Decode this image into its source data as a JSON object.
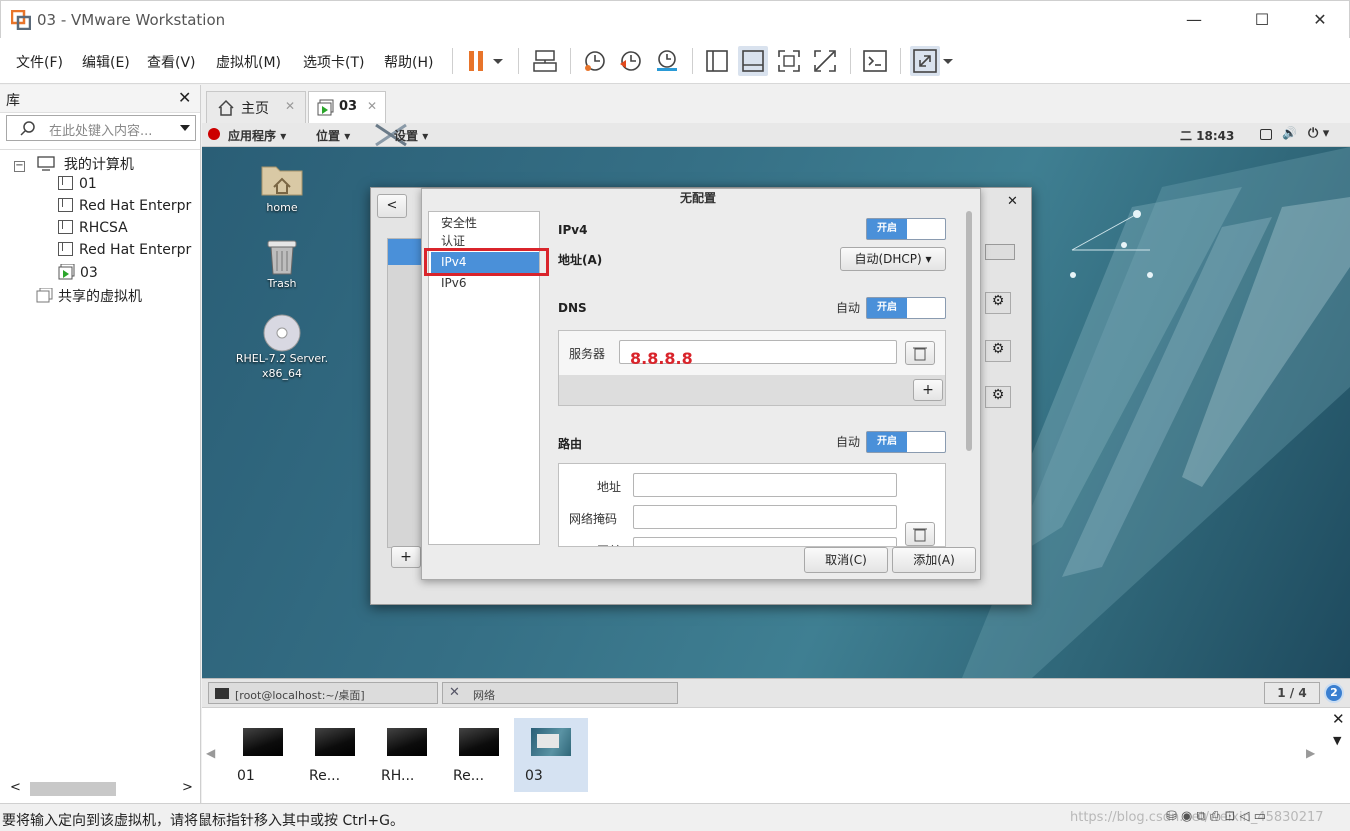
{
  "window": {
    "title": "03 - VMware Workstation",
    "minimize": "—",
    "maximize": "☐",
    "close": "✕"
  },
  "menu": [
    "文件(F)",
    "编辑(E)",
    "查看(V)",
    "虚拟机(M)",
    "选项卡(T)",
    "帮助(H)"
  ],
  "library": {
    "title": "库",
    "close": "✕",
    "search_placeholder": "在此处键入内容...",
    "root": "我的计算机",
    "vms": [
      "01",
      "Red Hat Enterpr",
      "RHCSA",
      "Red Hat Enterpr",
      "03"
    ],
    "shared": "共享的虚拟机"
  },
  "tabs": [
    {
      "label": "主页",
      "close": "✕"
    },
    {
      "label": "03",
      "close": "✕"
    }
  ],
  "guest": {
    "topbar": {
      "apps": "应用程序",
      "places": "位置",
      "settings": "设置",
      "time": "二 18:43"
    },
    "desktop_icons": [
      {
        "label": "home"
      },
      {
        "label": "Trash"
      },
      {
        "label": "RHEL-7.2 Server.\nx86_64"
      }
    ],
    "dialog": {
      "title": "无配置",
      "close": "✕",
      "back": "<",
      "add": "+",
      "sidebar": [
        "安全性",
        "认证",
        "IPv4",
        "IPv6"
      ],
      "selected": "IPv4",
      "ipv4_label": "IPv4",
      "ipv4_switch": "开启",
      "address_label": "地址(A)",
      "address_mode": "自动(DHCP)",
      "dns_label": "DNS",
      "dns_auto": "自动",
      "dns_switch": "开启",
      "server_label": "服务器",
      "server_value": "8.8.8.8",
      "route_label": "路由",
      "route_auto": "自动",
      "route_switch": "开启",
      "route_address": "地址",
      "route_netmask": "网络掩码",
      "route_gateway": "网关",
      "plus": "+",
      "cancel": "取消(C)",
      "ok": "添加(A)"
    },
    "taskbar": {
      "terminal": "[root@localhost:~/桌面]",
      "network": "网络",
      "workspace": "1 / 4",
      "badge": "2"
    }
  },
  "thumbnails": [
    {
      "label": "01"
    },
    {
      "label": "Re..."
    },
    {
      "label": "RH..."
    },
    {
      "label": "Re..."
    },
    {
      "label": "03"
    }
  ],
  "status": {
    "text": "要将输入定向到该虚拟机，请将鼠标指针移入其中或按 Ctrl+G。",
    "watermark": "https://blog.csdn.net/weixin_45830217"
  },
  "colors": {
    "accent": "#4a90d9",
    "highlight": "#d9242b",
    "server_value": "#d9242b",
    "pause": "#e8742a"
  }
}
